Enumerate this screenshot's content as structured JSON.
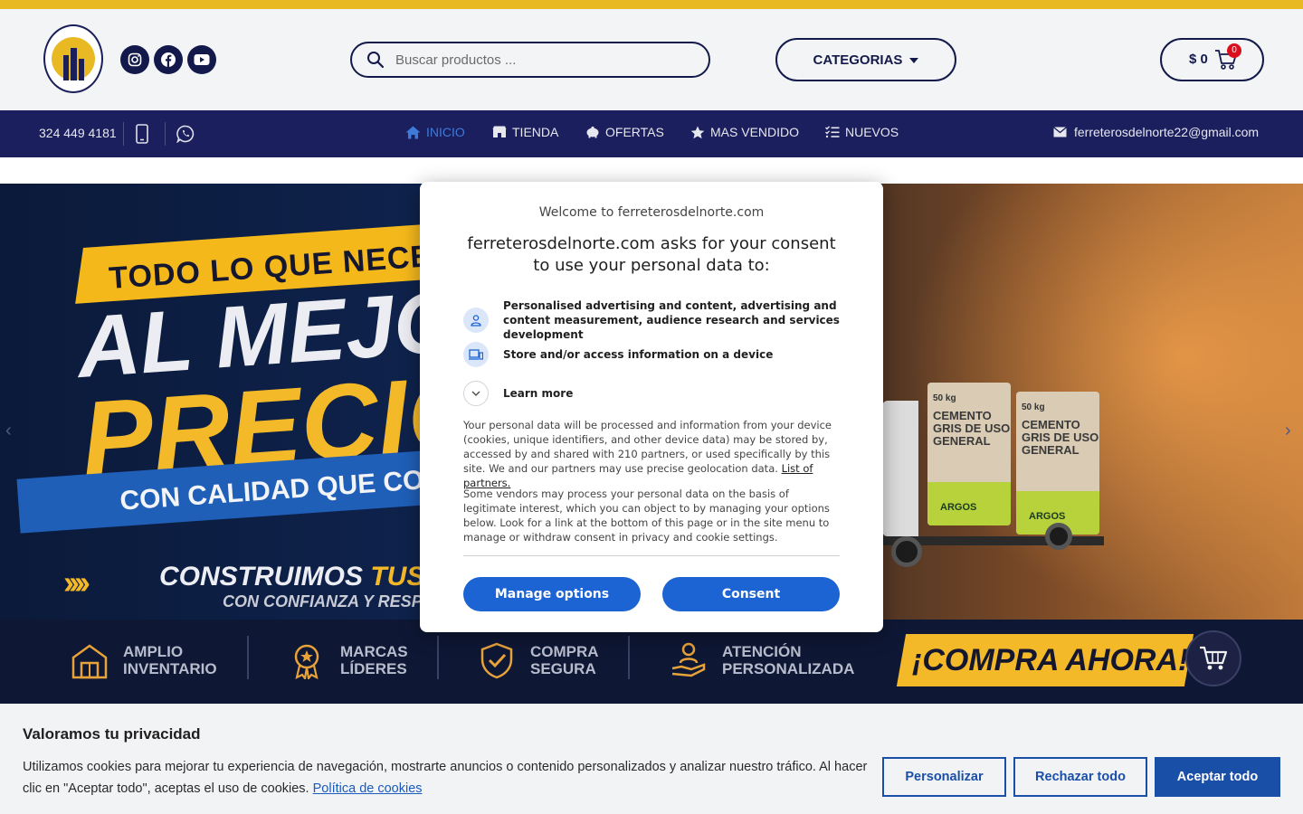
{
  "header": {
    "logo_name": "ferreteros-del-norte-logo",
    "social": [
      "instagram-icon",
      "facebook-icon",
      "youtube-icon"
    ],
    "search_placeholder": "Buscar productos ...",
    "categories_label": "CATEGORIAS",
    "cart_amount": "$ 0",
    "cart_count": "0"
  },
  "navbar": {
    "phone": "324 449 4181",
    "items": [
      {
        "label": "INICIO",
        "icon": "home-icon",
        "active": true
      },
      {
        "label": "TIENDA",
        "icon": "store-icon",
        "active": false
      },
      {
        "label": "OFERTAS",
        "icon": "piggy-bank-icon",
        "active": false
      },
      {
        "label": "MAS VENDIDO",
        "icon": "star-icon",
        "active": false
      },
      {
        "label": "NUEVOS",
        "icon": "checklist-icon",
        "active": false
      }
    ],
    "email": "ferreterosdelnorte22@gmail.com"
  },
  "hero": {
    "line1": "TODO LO QUE NECESITAS",
    "line2": "AL MEJOR",
    "line3": "PRECIO",
    "line4": "CON CALIDAD QUE CONSTRUYE",
    "line5_a": "CONSTRUIMOS ",
    "line5_b": "TUS PROYECTOS",
    "line6": "CON CONFIANZA Y RESPALDO",
    "bag_weight": "50 kg",
    "bag_text": "CEMENTO GRIS DE USO GENERAL",
    "bag_brand": "ARGOS",
    "features": [
      {
        "line1": "AMPLIO",
        "line2": "INVENTARIO"
      },
      {
        "line1": "MARCAS",
        "line2": "LÍDERES"
      },
      {
        "line1": "COMPRA",
        "line2": "SEGURA"
      },
      {
        "line1": "ATENCIÓN",
        "line2": "PERSONALIZADA"
      }
    ],
    "cta": "¡COMPRA AHORA!"
  },
  "consent": {
    "welcome": "Welcome to ferreterosdelnorte.com",
    "title": "ferreterosdelnorte.com asks for your consent to use your personal data to:",
    "purpose1": "Personalised advertising and content, advertising and content measurement, audience research and services development",
    "purpose2": "Store and/or access information on a device",
    "learn_more": "Learn more",
    "body1": "Your personal data will be processed and information from your device (cookies, unique identifiers, and other device data) may be stored by, accessed by and shared with 210 partners, or used specifically by this site. We and our partners may use precise geolocation data.",
    "partners_link": "List of partners.",
    "body2": "Some vendors may process your personal data on the basis of legitimate interest, which you can object to by managing your options below. Look for a link at the bottom of this page or in the site menu to manage or withdraw consent in privacy and cookie settings.",
    "manage_label": "Manage options",
    "consent_label": "Consent"
  },
  "cookie": {
    "title": "Valoramos tu privacidad",
    "text": "Utilizamos cookies para mejorar tu experiencia de navegación, mostrarte anuncios o contenido personalizados y analizar nuestro tráfico. Al hacer clic en \"Aceptar todo\", aceptas el uso de cookies.",
    "policy_link": "Política de cookies",
    "customize": "Personalizar",
    "reject": "Rechazar todo",
    "accept": "Aceptar todo"
  },
  "colors": {
    "accent_yellow": "#e8b923",
    "navy": "#1b1f5e",
    "primary_blue": "#1c63d3",
    "cookie_blue": "#1a4fa8"
  }
}
